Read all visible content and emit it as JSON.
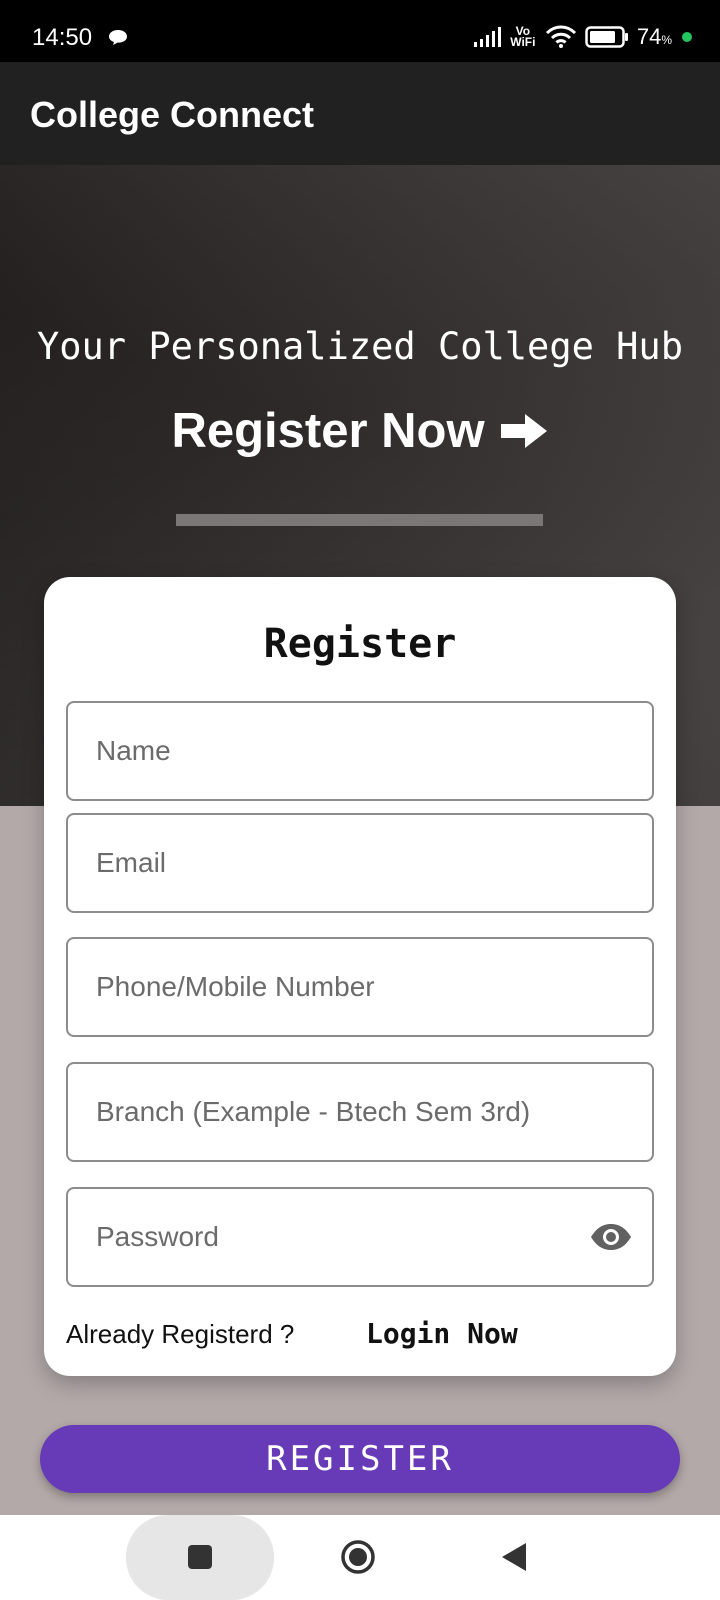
{
  "status_bar": {
    "time": "14:50",
    "network_label_top": "Vo",
    "network_label_bottom": "WiFi",
    "battery_value": "74",
    "battery_unit": "%"
  },
  "app_bar": {
    "title": "College Connect"
  },
  "hero": {
    "tagline": "Your Personalized College Hub",
    "cta_label": "Register Now"
  },
  "card": {
    "title": "Register",
    "fields": {
      "name_placeholder": "Name",
      "email_placeholder": "Email",
      "phone_placeholder": "Phone/Mobile Number",
      "branch_placeholder": "Branch (Example - Btech Sem 3rd)",
      "password_placeholder": "Password"
    },
    "already_registered": "Already Registerd ?",
    "login_link": "Login Now"
  },
  "register_button": {
    "label": "REGISTER"
  },
  "colors": {
    "accent": "#673ab7",
    "app_bar": "#212121",
    "page_bg": "#b3a9a9"
  },
  "icons": [
    "chat-bubble-icon",
    "signal-icon",
    "wifi-icon",
    "battery-icon",
    "arrow-right-icon",
    "eye-icon",
    "recents-icon",
    "home-icon",
    "back-icon"
  ]
}
